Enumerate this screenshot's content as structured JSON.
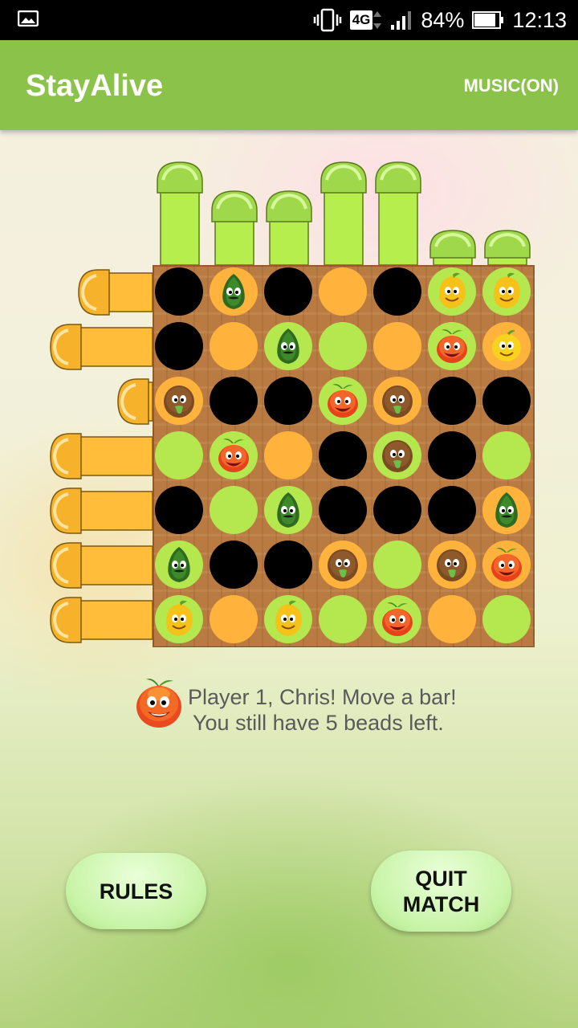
{
  "status_bar": {
    "network": "4G",
    "battery": "84%",
    "time": "12:13"
  },
  "app_bar": {
    "title": "StayAlive",
    "music_button": "MUSIC(ON)"
  },
  "board": {
    "size": 7,
    "cells": [
      [
        "hole",
        "orange:avocado",
        "hole",
        "orange",
        "hole",
        "green:mango",
        "green:mango"
      ],
      [
        "hole",
        "orange",
        "green:avocado",
        "green",
        "orange",
        "green:apple",
        "orange:lemon"
      ],
      [
        "orange:kiwi",
        "hole",
        "hole",
        "green:apple",
        "orange:kiwi",
        "hole",
        "hole"
      ],
      [
        "green",
        "green:apple",
        "orange",
        "hole",
        "green:kiwi",
        "hole",
        "green"
      ],
      [
        "hole",
        "green",
        "green:avocado",
        "hole",
        "hole",
        "hole",
        "orange:avocado"
      ],
      [
        "green:avocado",
        "hole",
        "hole",
        "orange:kiwi",
        "green",
        "orange:kiwi",
        "orange:apple"
      ],
      [
        "green:mango",
        "orange",
        "green:mango",
        "green",
        "green:apple",
        "orange",
        "green"
      ]
    ],
    "vertical_bars": [
      {
        "column": 1,
        "extension": "long"
      },
      {
        "column": 2,
        "extension": "medium"
      },
      {
        "column": 3,
        "extension": "medium"
      },
      {
        "column": 4,
        "extension": "long"
      },
      {
        "column": 5,
        "extension": "long"
      },
      {
        "column": 6,
        "extension": "short"
      },
      {
        "column": 7,
        "extension": "short"
      }
    ],
    "horizontal_bars": [
      {
        "row": 1,
        "extension": "medium"
      },
      {
        "row": 2,
        "extension": "long"
      },
      {
        "row": 3,
        "extension": "short"
      },
      {
        "row": 4,
        "extension": "long"
      },
      {
        "row": 5,
        "extension": "long"
      },
      {
        "row": 6,
        "extension": "long"
      },
      {
        "row": 7,
        "extension": "long"
      }
    ]
  },
  "message": {
    "line1": "Player 1, Chris! Move a bar!",
    "line2": "You still have 5 beads left.",
    "player_icon": "apple-icon"
  },
  "buttons": {
    "rules": "RULES",
    "quit_line1": "QUIT",
    "quit_line2": "MATCH"
  },
  "colors": {
    "app_bar": "#8bc34a",
    "vertical_bar": "#b5ee4d",
    "horizontal_bar": "#ffbd3a",
    "bead_orange": "#ffb33c",
    "bead_green": "#b5e84f",
    "board_wood": "#b97b42"
  }
}
